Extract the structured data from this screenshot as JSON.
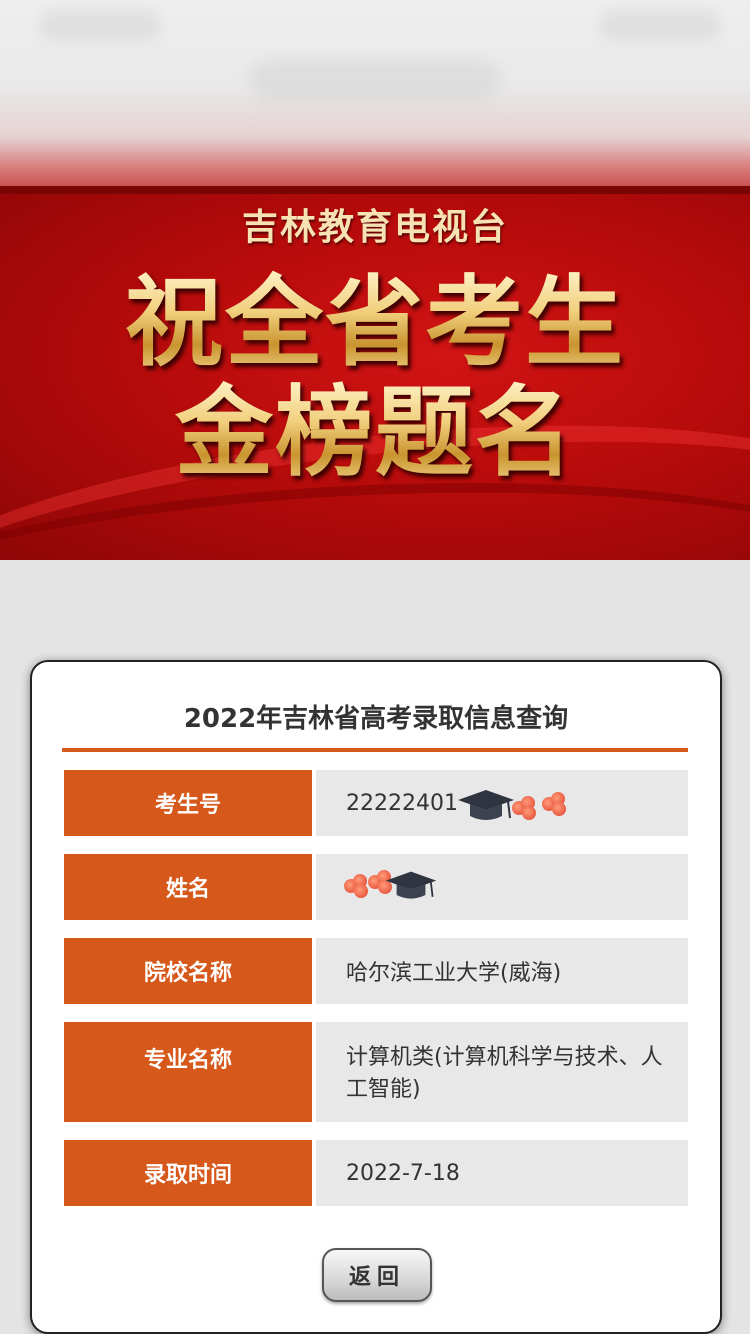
{
  "banner": {
    "subtitle": "吉林教育电视台",
    "line1": "祝全省考生",
    "line2": "金榜题名"
  },
  "card": {
    "title": "2022年吉林省高考录取信息查询",
    "rows": [
      {
        "label": "考生号",
        "value": "22222401"
      },
      {
        "label": "姓名",
        "value": ""
      },
      {
        "label": "院校名称",
        "value": "哈尔滨工业大学(威海)"
      },
      {
        "label": "专业名称",
        "value": "计算机类(计算机科学与技术、人工智能)"
      },
      {
        "label": "录取时间",
        "value": "2022-7-18"
      }
    ],
    "back_button": "返回"
  },
  "colors": {
    "accent": "#d6581b",
    "banner_red": "#b80b0b",
    "gold": "#f0cf82"
  },
  "icons": [
    "graduation-cap-icon",
    "flower-sticker-icon"
  ]
}
